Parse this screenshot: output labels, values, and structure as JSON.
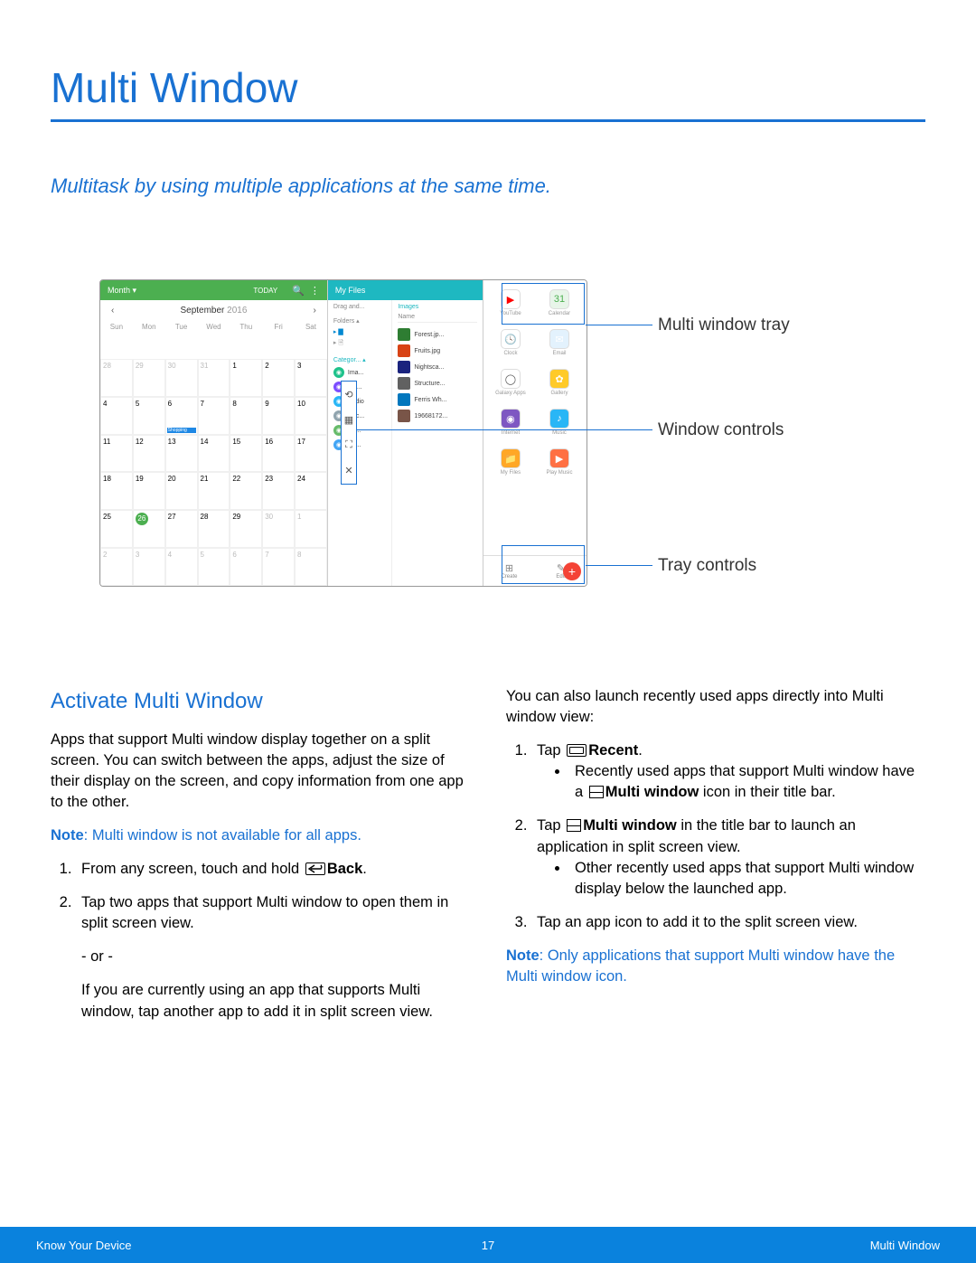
{
  "title": "Multi Window",
  "subtitle": "Multitask by using multiple applications at the same time.",
  "callouts": {
    "tray": "Multi window tray",
    "controls": "Window controls",
    "tray_controls": "Tray controls"
  },
  "calendar": {
    "dropdown": "Month ▾",
    "today": "TODAY",
    "month_label": "September",
    "month_year": "2016",
    "days": [
      "Sun",
      "Mon",
      "Tue",
      "Wed",
      "Thu",
      "Fri",
      "Sat"
    ],
    "weeks": [
      [
        "28",
        "29",
        "30",
        "31",
        "1",
        "2",
        "3"
      ],
      [
        "4",
        "5",
        "6",
        "7",
        "8",
        "9",
        "10"
      ],
      [
        "11",
        "12",
        "13",
        "14",
        "15",
        "16",
        "17"
      ],
      [
        "18",
        "19",
        "20",
        "21",
        "22",
        "23",
        "24"
      ],
      [
        "25",
        "26",
        "27",
        "28",
        "29",
        "30",
        "1"
      ],
      [
        "2",
        "3",
        "4",
        "5",
        "6",
        "7",
        "8"
      ]
    ],
    "event": "Shopping",
    "today_num": "26"
  },
  "files": {
    "header": "My Files",
    "left_head": "Drag and...",
    "folders_label": "Folders ▴",
    "categories_label": "Categor... ▴",
    "cats": [
      {
        "label": "Ima...",
        "color": "#1ec28b"
      },
      {
        "label": "Vid...",
        "color": "#7c4dff"
      },
      {
        "label": "Audio",
        "color": "#29b6f6"
      },
      {
        "label": "Doc...",
        "color": "#90a4ae"
      },
      {
        "label": "Do...",
        "color": "#66bb6a"
      },
      {
        "label": "Do...",
        "color": "#42a5f5"
      }
    ],
    "right_head": "Images",
    "right_sub": "Name",
    "thumbs": [
      "Forest.jp...",
      "Fruits.jpg",
      "Nightsca...",
      "Structure...",
      "Ferris Wh...",
      "19668172..."
    ]
  },
  "tray_apps": [
    {
      "label": "YouTube",
      "color": "#ffffff",
      "text": "▶",
      "red": true
    },
    {
      "label": "Calendar",
      "color": "#e8f5e9",
      "text": "31"
    },
    {
      "label": "Clock",
      "color": "#ffffff",
      "text": "🕓"
    },
    {
      "label": "Email",
      "color": "#e3f2fd",
      "text": "✉"
    },
    {
      "label": "Galaxy Apps",
      "color": "#ffffff",
      "text": "◯"
    },
    {
      "label": "Gallery",
      "color": "#ffca28",
      "text": "✿"
    },
    {
      "label": "Internet",
      "color": "#7e57c2",
      "text": "◉"
    },
    {
      "label": "Music",
      "color": "#29b6f6",
      "text": "♪"
    },
    {
      "label": "My Files",
      "color": "#ffa726",
      "text": "📁"
    },
    {
      "label": "Play Music",
      "color": "#ff7043",
      "text": "▶"
    }
  ],
  "tray_footer": {
    "create": "Create",
    "edit": "Edit"
  },
  "section_title": "Activate Multi Window",
  "left_col": {
    "intro": "Apps that support Multi window display together on a split screen. You can switch between the apps, adjust the size of their display on the screen, and copy information from one app to the other.",
    "note_prefix": "Note",
    "note_body": ": Multi window is not available for all apps.",
    "step1_a": "From any screen, touch and hold ",
    "step1_b": "Back",
    "step1_c": ".",
    "step2": "Tap two apps that support Multi window to open them in split screen view.",
    "or": "- or -",
    "step2b": "If you are currently using an app that supports Multi window, tap another app to add it in split screen view."
  },
  "right_col": {
    "intro": "You can also launch recently used apps directly into Multi window view:",
    "step1_a": "Tap ",
    "step1_b": "Recent",
    "step1_c": ".",
    "bullet1_a": "Recently used apps that support Multi window have a ",
    "bullet1_b": "Multi window",
    "bullet1_c": " icon in their title bar.",
    "step2_a": "Tap ",
    "step2_b": "Multi window",
    "step2_c": " in the title bar to launch an application in split screen view.",
    "bullet2": "Other recently used apps that support Multi window display below the launched app.",
    "step3": "Tap an app icon to add it to the split screen view.",
    "note_prefix": "Note",
    "note_body": ": Only applications that support Multi window have the Multi window icon."
  },
  "footer": {
    "left": "Know Your Device",
    "center": "17",
    "right": "Multi Window"
  }
}
